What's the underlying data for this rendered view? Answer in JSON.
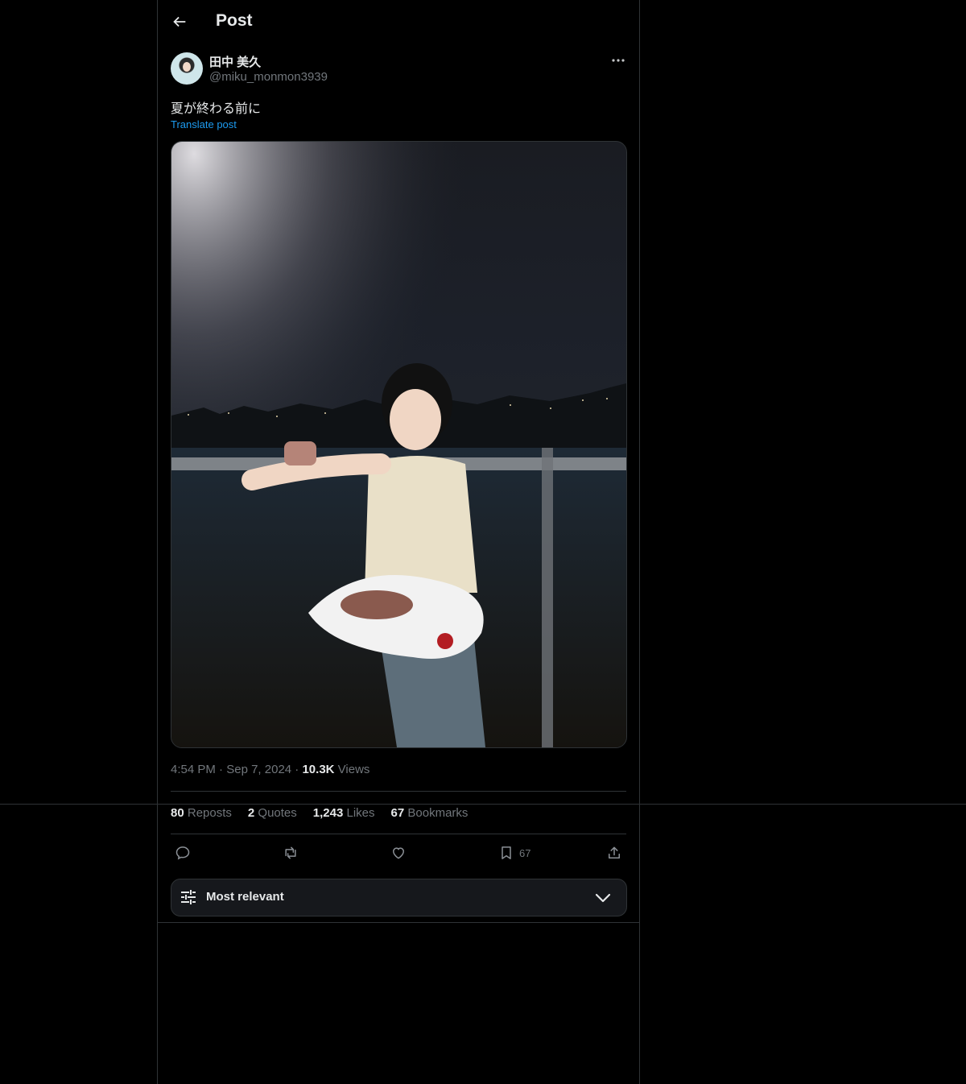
{
  "header": {
    "title": "Post"
  },
  "author": {
    "display_name": "田中 美久",
    "handle": "@miku_monmon3939"
  },
  "post": {
    "text": "夏が終わる前に",
    "translate_label": "Translate post",
    "time": "4:54 PM",
    "date": "Sep 7, 2024",
    "views_count": "10.3K",
    "views_label": "Views"
  },
  "stats": {
    "reposts_count": "80",
    "reposts_label": "Reposts",
    "quotes_count": "2",
    "quotes_label": "Quotes",
    "likes_count": "1,243",
    "likes_label": "Likes",
    "bookmarks_count": "67",
    "bookmarks_label": "Bookmarks"
  },
  "actions": {
    "bookmark_count": "67"
  },
  "sort": {
    "label": "Most relevant"
  },
  "icons": {
    "back": "arrow-left-icon",
    "more": "ellipsis-icon",
    "reply": "reply-icon",
    "repost": "repost-icon",
    "like": "heart-icon",
    "bookmark": "bookmark-icon",
    "share": "share-icon",
    "filter": "sliders-icon",
    "chevron": "chevron-down-icon"
  },
  "colors": {
    "background": "#000000",
    "text": "#e7e9ea",
    "muted": "#71767b",
    "link": "#1d9bf0",
    "border": "#2f3336"
  }
}
